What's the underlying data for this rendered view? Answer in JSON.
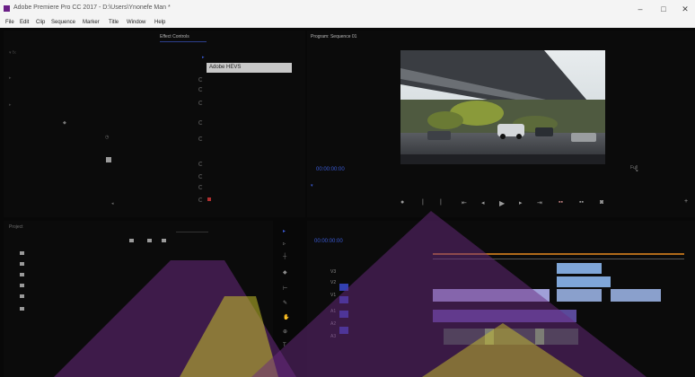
{
  "window": {
    "title": "Adobe Premiere Pro CC 2017 - D:\\Users\\Ynonefe Man *",
    "controls": {
      "minimize": "–",
      "maximize": "□",
      "close": "✕"
    }
  },
  "menu": [
    "File",
    "Edit",
    "Clip",
    "Sequence",
    "Marker",
    "Title",
    "Window",
    "Help"
  ],
  "effect_controls": {
    "tab_label": "Effect Controls",
    "dropdown_value": "Adobe HEVS"
  },
  "program": {
    "tab_label": "Program: Sequence 01",
    "timecode": "00:00:00:00",
    "fit": "Full"
  },
  "project": {
    "tab_label": "Project"
  },
  "timeline": {
    "timecode": "00:00:00:00",
    "tracks": [
      "V3",
      "V2",
      "V1",
      "A1",
      "A2",
      "A3"
    ]
  },
  "colors": {
    "accent_blue": "#3b5bd6",
    "overlay_purple": "#6a2a80",
    "overlay_yellow": "#c9c22b"
  }
}
